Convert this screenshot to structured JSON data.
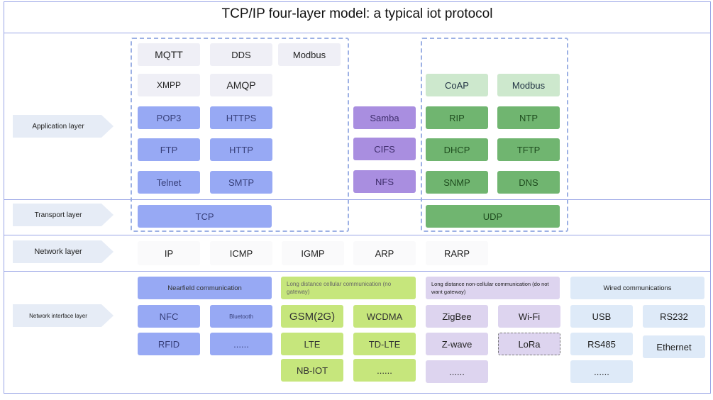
{
  "title": "TCP/IP four-layer model: a typical iot protocol",
  "layers": {
    "application": "Application layer",
    "transport": "Transport layer",
    "network": "Network layer",
    "interface": "Network interface layer"
  },
  "application": {
    "left": [
      "MQTT",
      "DDS",
      "Modbus",
      "XMPP",
      "AMQP",
      "POP3",
      "HTTPS",
      "FTP",
      "HTTP",
      "Telnet",
      "SMTP"
    ],
    "middle": [
      "Samba",
      "CIFS",
      "NFS"
    ],
    "right": [
      "CoAP",
      "Modbus",
      "RIP",
      "NTP",
      "DHCP",
      "TFTP",
      "SNMP",
      "DNS"
    ]
  },
  "transport": {
    "tcp": "TCP",
    "udp": "UDP"
  },
  "network": [
    "IP",
    "ICMP",
    "IGMP",
    "ARP",
    "RARP"
  ],
  "interface": {
    "nearfield": {
      "header": "Nearfield communication",
      "items": [
        "NFC",
        "Bluetooth",
        "RFID",
        "......"
      ]
    },
    "cellular": {
      "header": "Long distance cellular communication (no gateway)",
      "items": [
        "GSM(2G)",
        "WCDMA",
        "LTE",
        "TD-LTE",
        "NB-IOT",
        "......"
      ]
    },
    "noncellular": {
      "header": "Long distance non-cellular communication (do not want gateway)",
      "items": [
        "ZigBee",
        "Wi-Fi",
        "Z-wave",
        "LoRa",
        "......"
      ]
    },
    "wired": {
      "header": "Wired communications",
      "items": [
        "USB",
        "RS232",
        "RS485",
        "Ethernet",
        "......"
      ]
    }
  },
  "colors": {
    "tcp_family": "#97a9f4",
    "file_sharing": "#a98ee0",
    "udp_family": "#70b570",
    "cellular": "#c6e67c",
    "noncellular": "#ddd4ef",
    "wired": "#deeaf8",
    "border": "#9aa6e6"
  }
}
